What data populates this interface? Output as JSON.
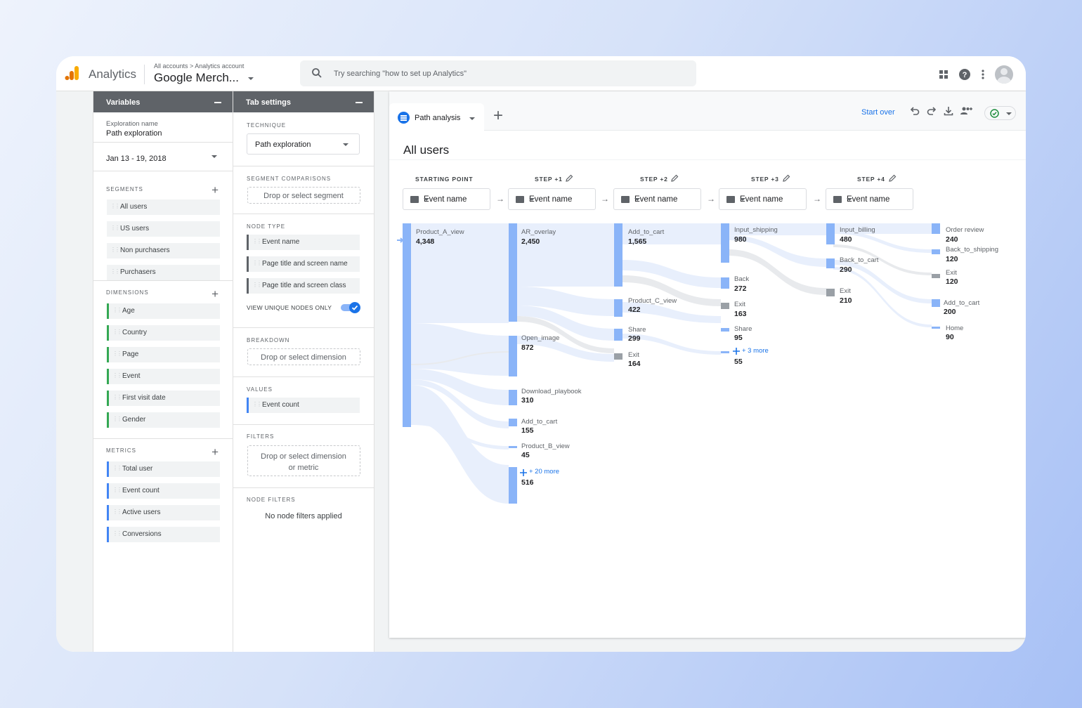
{
  "header": {
    "app_name": "Analytics",
    "breadcrumb": "All accounts > Analytics account",
    "property": "Google Merch...",
    "search_placeholder": "Try searching \"how to set up Analytics\""
  },
  "variables": {
    "title": "Variables",
    "exploration_label": "Exploration name",
    "exploration_name": "Path exploration",
    "date_range": "Jan 13 - 19, 2018",
    "segments_title": "SEGMENTS",
    "segments": [
      "All users",
      "US users",
      "Non purchasers",
      "Purchasers"
    ],
    "dimensions_title": "DIMENSIONS",
    "dimensions": [
      "Age",
      "Country",
      "Page",
      "Event",
      "First visit date",
      "Gender"
    ],
    "metrics_title": "METRICS",
    "metrics": [
      "Total user",
      "Event count",
      "Active users",
      "Conversions"
    ]
  },
  "tab_settings": {
    "title": "Tab settings",
    "technique_title": "TECHNIQUE",
    "technique": "Path exploration",
    "segment_comparisons_title": "SEGMENT COMPARISONS",
    "segment_drop": "Drop or select segment",
    "node_type_title": "NODE TYPE",
    "node_types": [
      "Event name",
      "Page title and screen name",
      "Page title and screen class"
    ],
    "unique_nodes_label": "VIEW UNIQUE NODES ONLY",
    "breakdown_title": "BREAKDOWN",
    "breakdown_drop": "Drop or select dimension",
    "values_title": "VALUES",
    "value_item": "Event count",
    "filters_title": "FILTERS",
    "filters_drop_1": "Drop or select dimension",
    "filters_drop_2": "or metric",
    "node_filters_title": "NODE FILTERS",
    "node_filters_text": "No node filters applied"
  },
  "canvas": {
    "tab_label": "Path analysis",
    "start_over": "Start over",
    "segment_title": "All users",
    "steps": [
      "STARTING POINT",
      "STEP +1",
      "STEP +2",
      "STEP +3",
      "STEP +4"
    ],
    "step_dimension": "Event name",
    "nodes": {
      "s0": [
        {
          "label": "Product_A_view",
          "value": "4,348"
        }
      ],
      "s1": [
        {
          "label": "AR_overlay",
          "value": "2,450"
        },
        {
          "label": "Open_image",
          "value": "872"
        },
        {
          "label": "Download_playbook",
          "value": "310"
        },
        {
          "label": "Add_to_cart",
          "value": "155"
        },
        {
          "label": "Product_B_view",
          "value": "45"
        },
        {
          "label": "+ 20 more",
          "value": "516"
        }
      ],
      "s2": [
        {
          "label": "Add_to_cart",
          "value": "1,565"
        },
        {
          "label": "Product_C_view",
          "value": "422"
        },
        {
          "label": "Share",
          "value": "299"
        },
        {
          "label": "Exit",
          "value": "164"
        }
      ],
      "s3": [
        {
          "label": "Input_shipping",
          "value": "980"
        },
        {
          "label": "Back",
          "value": "272"
        },
        {
          "label": "Exit",
          "value": "163"
        },
        {
          "label": "Share",
          "value": "95"
        },
        {
          "label": "+ 3 more",
          "value": "55"
        }
      ],
      "s4": [
        {
          "label": "Input_billing",
          "value": "480"
        },
        {
          "label": "Back_to_cart",
          "value": "290"
        },
        {
          "label": "Exit",
          "value": "210"
        }
      ],
      "s5": [
        {
          "label": "Order review",
          "value": "240"
        },
        {
          "label": "Back_to_shipping",
          "value": "120"
        },
        {
          "label": "Exit",
          "value": "120"
        },
        {
          "label": "Add_to_cart",
          "value": "200"
        },
        {
          "label": "Home",
          "value": "90"
        }
      ]
    }
  },
  "colors": {
    "accent": "#1a73e8",
    "node": "#8ab4f8",
    "flow": "#e8effc",
    "exit": "#9aa0a6",
    "brand_orange": "#f9ab00",
    "brand_dark": "#e37400"
  }
}
